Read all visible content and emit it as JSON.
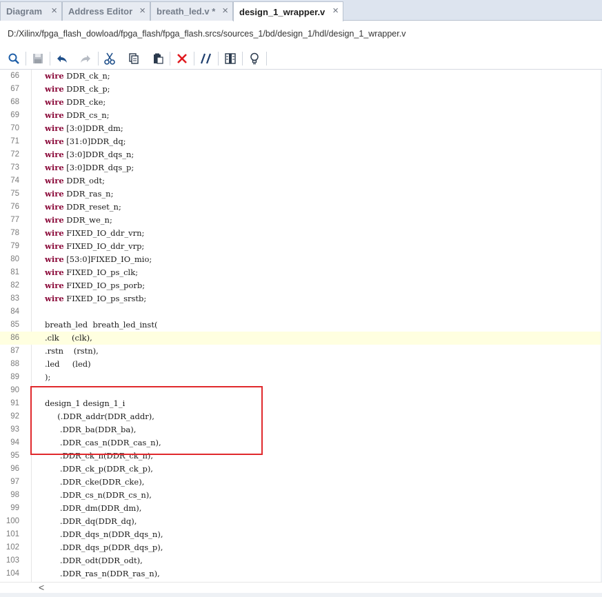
{
  "tabs": [
    {
      "label": "Diagram",
      "active": false
    },
    {
      "label": "Address Editor",
      "active": false
    },
    {
      "label": "breath_led.v *",
      "active": false
    },
    {
      "label": "design_1_wrapper.v",
      "active": true
    }
  ],
  "close_glyph": "×",
  "file_path": "D:/Xilinx/fpga_flash_dowload/fpga_flash/fpga_flash.srcs/sources_1/bd/design_1/hdl/design_1_wrapper.v",
  "toolbar_icons": [
    "search-icon",
    "save-icon",
    "undo-icon",
    "redo-icon",
    "cut-icon",
    "copy-icon",
    "paste-icon",
    "delete-icon",
    "comment-icon",
    "column-icon",
    "lightbulb-icon"
  ],
  "colors": {
    "keyword": "#8b0a3a",
    "highlight_line": "#ffffe0",
    "annotation_box": "#e0282c"
  },
  "highlighted_line": "86",
  "code_lines": [
    {
      "n": "66",
      "kw": "wire",
      "rest": " DDR_ck_n;"
    },
    {
      "n": "67",
      "kw": "wire",
      "rest": " DDR_ck_p;"
    },
    {
      "n": "68",
      "kw": "wire",
      "rest": " DDR_cke;"
    },
    {
      "n": "69",
      "kw": "wire",
      "rest": " DDR_cs_n;"
    },
    {
      "n": "70",
      "kw": "wire",
      "rest": " [3:0]DDR_dm;"
    },
    {
      "n": "71",
      "kw": "wire",
      "rest": " [31:0]DDR_dq;"
    },
    {
      "n": "72",
      "kw": "wire",
      "rest": " [3:0]DDR_dqs_n;"
    },
    {
      "n": "73",
      "kw": "wire",
      "rest": " [3:0]DDR_dqs_p;"
    },
    {
      "n": "74",
      "kw": "wire",
      "rest": " DDR_odt;"
    },
    {
      "n": "75",
      "kw": "wire",
      "rest": " DDR_ras_n;"
    },
    {
      "n": "76",
      "kw": "wire",
      "rest": " DDR_reset_n;"
    },
    {
      "n": "77",
      "kw": "wire",
      "rest": " DDR_we_n;"
    },
    {
      "n": "78",
      "kw": "wire",
      "rest": " FIXED_IO_ddr_vrn;"
    },
    {
      "n": "79",
      "kw": "wire",
      "rest": " FIXED_IO_ddr_vrp;"
    },
    {
      "n": "80",
      "kw": "wire",
      "rest": " [53:0]FIXED_IO_mio;"
    },
    {
      "n": "81",
      "kw": "wire",
      "rest": " FIXED_IO_ps_clk;"
    },
    {
      "n": "82",
      "kw": "wire",
      "rest": " FIXED_IO_ps_porb;"
    },
    {
      "n": "83",
      "kw": "wire",
      "rest": " FIXED_IO_ps_srstb;"
    },
    {
      "n": "84",
      "kw": "",
      "rest": ""
    },
    {
      "n": "85",
      "kw": "",
      "rest": "breath_led  breath_led_inst("
    },
    {
      "n": "86",
      "kw": "",
      "rest": ".clk     (clk),"
    },
    {
      "n": "87",
      "kw": "",
      "rest": ".rstn    (rstn),"
    },
    {
      "n": "88",
      "kw": "",
      "rest": ".led     (led)"
    },
    {
      "n": "89",
      "kw": "",
      "rest": ");"
    },
    {
      "n": "90",
      "kw": "",
      "rest": ""
    },
    {
      "n": "91",
      "kw": "",
      "rest": "design_1 design_1_i"
    },
    {
      "n": "92",
      "kw": "",
      "rest": "     (.DDR_addr(DDR_addr),"
    },
    {
      "n": "93",
      "kw": "",
      "rest": "      .DDR_ba(DDR_ba),"
    },
    {
      "n": "94",
      "kw": "",
      "rest": "      .DDR_cas_n(DDR_cas_n),"
    },
    {
      "n": "95",
      "kw": "",
      "rest": "      .DDR_ck_n(DDR_ck_n),"
    },
    {
      "n": "96",
      "kw": "",
      "rest": "      .DDR_ck_p(DDR_ck_p),"
    },
    {
      "n": "97",
      "kw": "",
      "rest": "      .DDR_cke(DDR_cke),"
    },
    {
      "n": "98",
      "kw": "",
      "rest": "      .DDR_cs_n(DDR_cs_n),"
    },
    {
      "n": "99",
      "kw": "",
      "rest": "      .DDR_dm(DDR_dm),"
    },
    {
      "n": "100",
      "kw": "",
      "rest": "      .DDR_dq(DDR_dq),"
    },
    {
      "n": "101",
      "kw": "",
      "rest": "      .DDR_dqs_n(DDR_dqs_n),"
    },
    {
      "n": "102",
      "kw": "",
      "rest": "      .DDR_dqs_p(DDR_dqs_p),"
    },
    {
      "n": "103",
      "kw": "",
      "rest": "      .DDR_odt(DDR_odt),"
    },
    {
      "n": "104",
      "kw": "",
      "rest": "      .DDR_ras_n(DDR_ras_n),"
    }
  ],
  "scroll_left_glyph": "<"
}
